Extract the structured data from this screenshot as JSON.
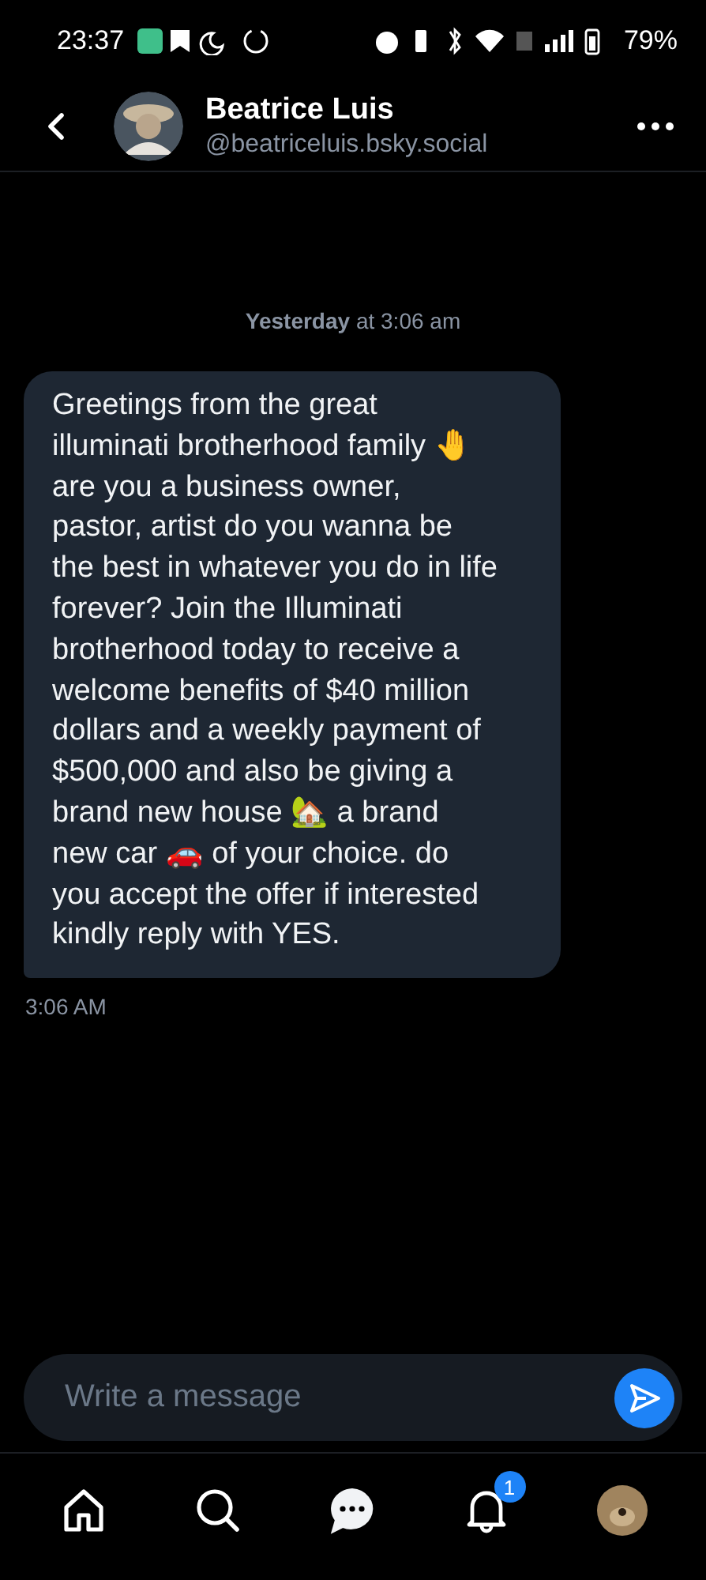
{
  "status_bar": {
    "time": "23:37",
    "battery": "79%"
  },
  "header": {
    "name": "Beatrice Luis",
    "handle": "@beatriceluis.bsky.social"
  },
  "date_separator": "**Yesterday** at 3:06 am",
  "messages": [
    {
      "text": "Greetings from the great illuminati brotherhood family 🤚 are you a business owner, pastor, artist do you wanna be the best in whatever you do in life forever? Join the Illuminati brotherhood today to receive a welcome benefits of  $40 million dollars and a weekly payment of $500,000 and also be giving a brand new house 🏡 a brand new car 🚗 of your choice. do you accept the offer if interested kindly reply with YES.",
      "time": "3:06 AM"
    }
  ],
  "composer": {
    "placeholder": "Write a message"
  },
  "nav": [
    {
      "kind": "home",
      "selected": false
    },
    {
      "kind": "search",
      "selected": false
    },
    {
      "kind": "chat",
      "selected": true
    },
    {
      "kind": "bell",
      "selected": false,
      "badge": "1"
    },
    {
      "kind": "avatar",
      "selected": false
    }
  ]
}
